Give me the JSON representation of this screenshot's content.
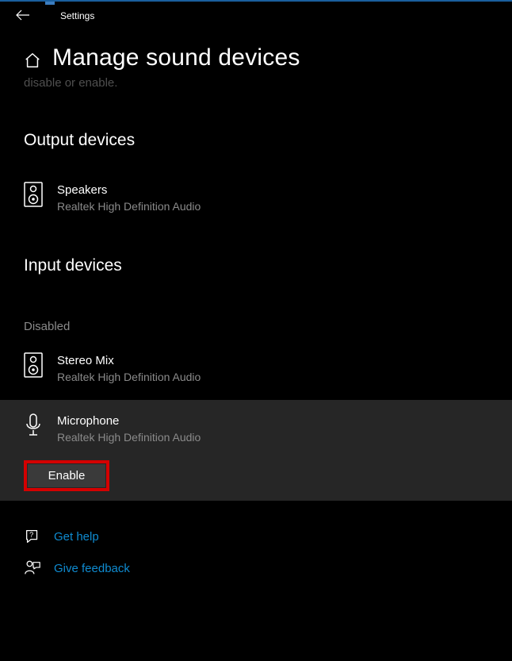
{
  "titlebar": {
    "label": "Settings"
  },
  "header": {
    "title": "Manage sound devices"
  },
  "truncated": "disable or enable.",
  "sections": {
    "output": {
      "heading": "Output devices",
      "devices": [
        {
          "name": "Speakers",
          "sub": "Realtek High Definition Audio"
        }
      ]
    },
    "input": {
      "heading": "Input devices",
      "group_label": "Disabled",
      "devices": [
        {
          "name": "Stereo Mix",
          "sub": "Realtek High Definition Audio"
        },
        {
          "name": "Microphone",
          "sub": "Realtek High Definition Audio"
        }
      ]
    }
  },
  "enable_button": "Enable",
  "footer": {
    "help": "Get help",
    "feedback": "Give feedback"
  }
}
